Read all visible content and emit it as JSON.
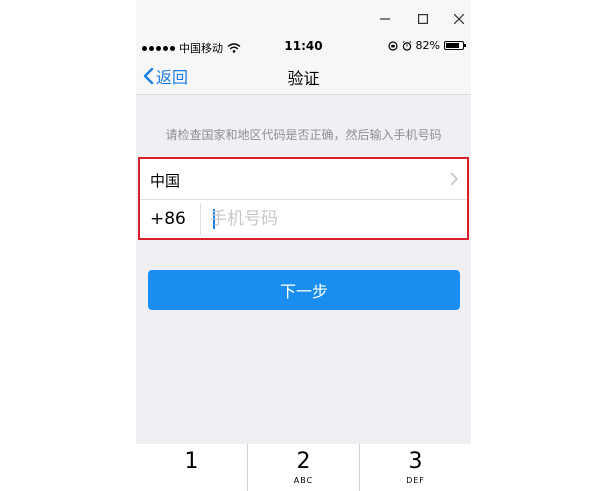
{
  "window_controls": {
    "minimize": "—",
    "maximize": "☐",
    "close": "✕"
  },
  "status_bar": {
    "carrier": "中国移动",
    "time": "11:40",
    "battery": "82%",
    "battery_level": 0.82
  },
  "nav": {
    "back_label": "返回",
    "title": "验证"
  },
  "hint": "请检查国家和地区代码是否正确，然后输入手机号码",
  "form": {
    "country": "中国",
    "country_code": "+86",
    "phone_placeholder": "手机号码",
    "phone_value": ""
  },
  "next_button": "下一步",
  "keypad": [
    {
      "num": "1",
      "letters": ""
    },
    {
      "num": "2",
      "letters": "ABC"
    },
    {
      "num": "3",
      "letters": "DEF"
    }
  ],
  "colors": {
    "accent": "#1a8ef0",
    "highlight_border": "#d6202b"
  }
}
